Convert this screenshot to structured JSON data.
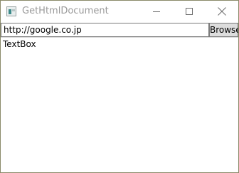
{
  "window": {
    "title": "GetHtmlDocument"
  },
  "address_bar": {
    "url_value": "http://google.co.jp",
    "browse_label": "Browse"
  },
  "content": {
    "textbox_text": "TextBox"
  }
}
